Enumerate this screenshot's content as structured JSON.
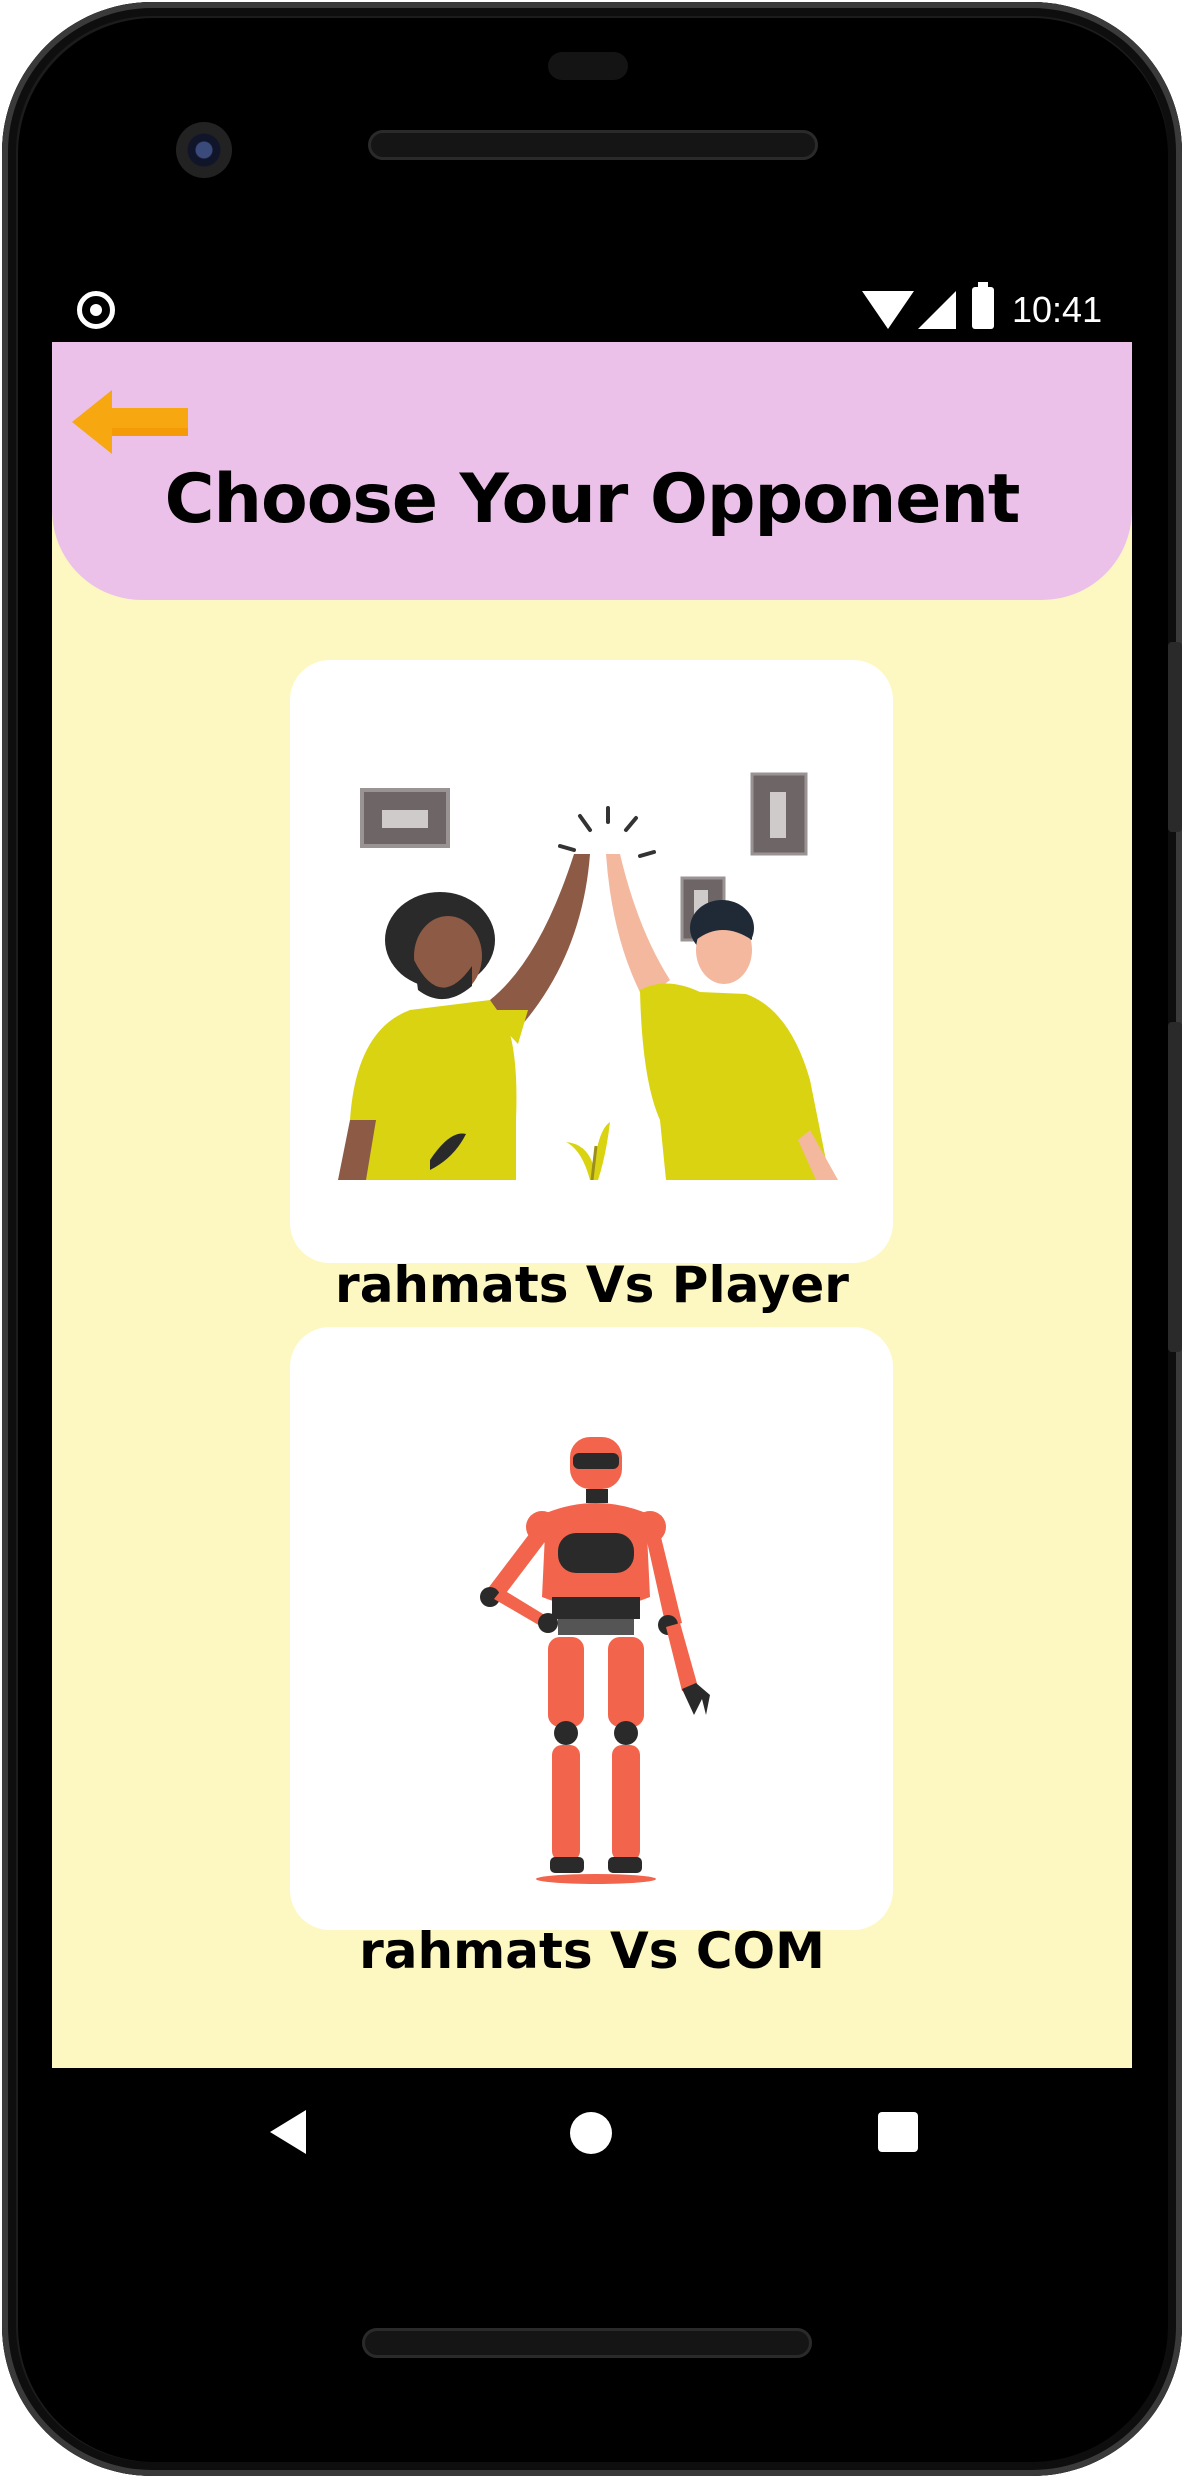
{
  "status_bar": {
    "time": "10:41"
  },
  "header": {
    "title": "Choose Your Opponent"
  },
  "options": [
    {
      "label": "rahmats Vs Player",
      "illustration": "two-people-high-five-illustration"
    },
    {
      "label": "rahmats Vs COM",
      "illustration": "robot-illustration"
    }
  ],
  "colors": {
    "header_bg": "#ebc1e9",
    "screen_bg": "#fdf8c2",
    "card_bg": "#ffffff",
    "back_arrow": "#f7a70f",
    "shirt_yellow": "#d9d312",
    "robot_orange": "#f2644c"
  },
  "icons": {
    "back": "arrow-left-icon",
    "nav_back": "triangle-back-icon",
    "nav_home": "circle-home-icon",
    "nav_recents": "square-recents-icon"
  }
}
